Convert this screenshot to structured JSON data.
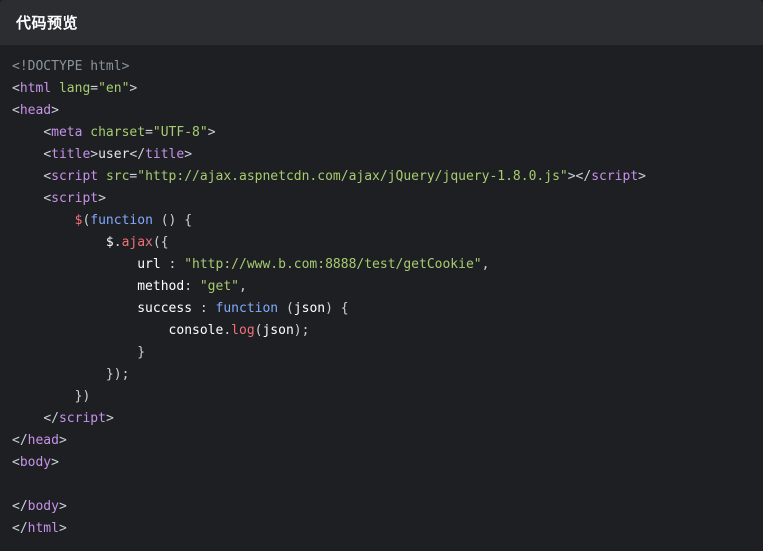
{
  "header": {
    "title": "代码预览"
  },
  "code": {
    "lines": [
      [
        {
          "t": "doctype",
          "v": "<!DOCTYPE html>"
        }
      ],
      [
        {
          "t": "punct",
          "v": "<"
        },
        {
          "t": "tag",
          "v": "html"
        },
        {
          "t": "text",
          "v": " "
        },
        {
          "t": "attr",
          "v": "lang"
        },
        {
          "t": "eq",
          "v": "="
        },
        {
          "t": "str",
          "v": "\"en\""
        },
        {
          "t": "punct",
          "v": ">"
        }
      ],
      [
        {
          "t": "punct",
          "v": "<"
        },
        {
          "t": "tag",
          "v": "head"
        },
        {
          "t": "punct",
          "v": ">"
        }
      ],
      [
        {
          "t": "text",
          "v": "    "
        },
        {
          "t": "punct",
          "v": "<"
        },
        {
          "t": "tag",
          "v": "meta"
        },
        {
          "t": "text",
          "v": " "
        },
        {
          "t": "attr",
          "v": "charset"
        },
        {
          "t": "eq",
          "v": "="
        },
        {
          "t": "str",
          "v": "\"UTF-8\""
        },
        {
          "t": "punct",
          "v": ">"
        }
      ],
      [
        {
          "t": "text",
          "v": "    "
        },
        {
          "t": "punct",
          "v": "<"
        },
        {
          "t": "tag",
          "v": "title"
        },
        {
          "t": "punct",
          "v": ">"
        },
        {
          "t": "text",
          "v": "user"
        },
        {
          "t": "punct",
          "v": "</"
        },
        {
          "t": "tag",
          "v": "title"
        },
        {
          "t": "punct",
          "v": ">"
        }
      ],
      [
        {
          "t": "text",
          "v": "    "
        },
        {
          "t": "punct",
          "v": "<"
        },
        {
          "t": "tag",
          "v": "script"
        },
        {
          "t": "text",
          "v": " "
        },
        {
          "t": "attr",
          "v": "src"
        },
        {
          "t": "eq",
          "v": "="
        },
        {
          "t": "str",
          "v": "\"http://ajax.aspnetcdn.com/ajax/jQuery/jquery-1.8.0.js\""
        },
        {
          "t": "punct",
          "v": ">"
        },
        {
          "t": "punct",
          "v": "</"
        },
        {
          "t": "tag",
          "v": "script"
        },
        {
          "t": "punct",
          "v": ">"
        }
      ],
      [
        {
          "t": "text",
          "v": "    "
        },
        {
          "t": "punct",
          "v": "<"
        },
        {
          "t": "tag",
          "v": "script"
        },
        {
          "t": "punct",
          "v": ">"
        }
      ],
      [
        {
          "t": "text",
          "v": "        "
        },
        {
          "t": "dollar",
          "v": "$"
        },
        {
          "t": "punct",
          "v": "("
        },
        {
          "t": "kw",
          "v": "function"
        },
        {
          "t": "punct",
          "v": " () {"
        }
      ],
      [
        {
          "t": "text",
          "v": "            "
        },
        {
          "t": "ident",
          "v": "$"
        },
        {
          "t": "punct",
          "v": "."
        },
        {
          "t": "method",
          "v": "ajax"
        },
        {
          "t": "punct",
          "v": "({"
        }
      ],
      [
        {
          "t": "text",
          "v": "                "
        },
        {
          "t": "prop",
          "v": "url"
        },
        {
          "t": "colon",
          "v": " : "
        },
        {
          "t": "str",
          "v": "\"http://www.b.com:8888/test/getCookie\""
        },
        {
          "t": "punct",
          "v": ","
        }
      ],
      [
        {
          "t": "text",
          "v": "                "
        },
        {
          "t": "prop",
          "v": "method"
        },
        {
          "t": "colon",
          "v": ": "
        },
        {
          "t": "str",
          "v": "\"get\""
        },
        {
          "t": "punct",
          "v": ","
        }
      ],
      [
        {
          "t": "text",
          "v": "                "
        },
        {
          "t": "prop",
          "v": "success"
        },
        {
          "t": "colon",
          "v": " : "
        },
        {
          "t": "kw",
          "v": "function"
        },
        {
          "t": "punct",
          "v": " ("
        },
        {
          "t": "ident",
          "v": "json"
        },
        {
          "t": "punct",
          "v": ") {"
        }
      ],
      [
        {
          "t": "text",
          "v": "                    "
        },
        {
          "t": "ident",
          "v": "console"
        },
        {
          "t": "punct",
          "v": "."
        },
        {
          "t": "method",
          "v": "log"
        },
        {
          "t": "punct",
          "v": "("
        },
        {
          "t": "ident",
          "v": "json"
        },
        {
          "t": "punct",
          "v": ");"
        }
      ],
      [
        {
          "t": "text",
          "v": "                "
        },
        {
          "t": "punct",
          "v": "}"
        }
      ],
      [
        {
          "t": "text",
          "v": "            "
        },
        {
          "t": "punct",
          "v": "});"
        }
      ],
      [
        {
          "t": "text",
          "v": "        "
        },
        {
          "t": "punct",
          "v": "})"
        }
      ],
      [
        {
          "t": "text",
          "v": "    "
        },
        {
          "t": "punct",
          "v": "</"
        },
        {
          "t": "tag",
          "v": "script"
        },
        {
          "t": "punct",
          "v": ">"
        }
      ],
      [
        {
          "t": "punct",
          "v": "</"
        },
        {
          "t": "tag",
          "v": "head"
        },
        {
          "t": "punct",
          "v": ">"
        }
      ],
      [
        {
          "t": "punct",
          "v": "<"
        },
        {
          "t": "tag",
          "v": "body"
        },
        {
          "t": "punct",
          "v": ">"
        }
      ],
      [],
      [
        {
          "t": "punct",
          "v": "</"
        },
        {
          "t": "tag",
          "v": "body"
        },
        {
          "t": "punct",
          "v": ">"
        }
      ],
      [
        {
          "t": "punct",
          "v": "</"
        },
        {
          "t": "tag",
          "v": "html"
        },
        {
          "t": "punct",
          "v": ">"
        }
      ]
    ]
  }
}
